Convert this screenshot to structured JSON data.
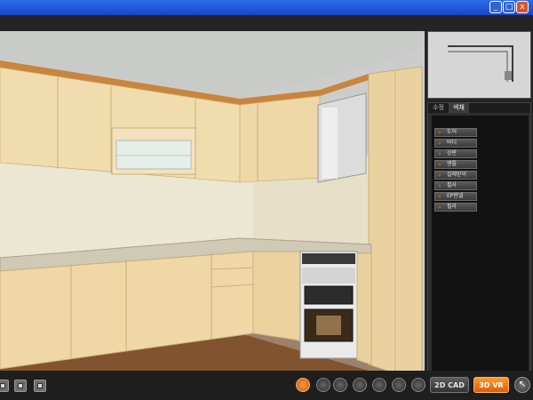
{
  "window": {
    "minimize_glyph": "_",
    "maximize_glyph": "□",
    "close_glyph": "x"
  },
  "panel": {
    "tabs": [
      "수정",
      "색채"
    ],
    "items": [
      "도어",
      "바디",
      "상판",
      "엔틀",
      "걸레받이",
      "필사",
      "EP판넬",
      "필라"
    ],
    "bullet_glyph": "»"
  },
  "toolbar": {
    "mode_2d": "2D CAD",
    "mode_3d": "3D VR",
    "cursor_glyph": "↖"
  },
  "colors": {
    "titlebar": "#1f5be0",
    "accent_orange": "#e8761c",
    "cabinet_wood": "#edd7aa",
    "floor_wood": "#8a5a32"
  }
}
